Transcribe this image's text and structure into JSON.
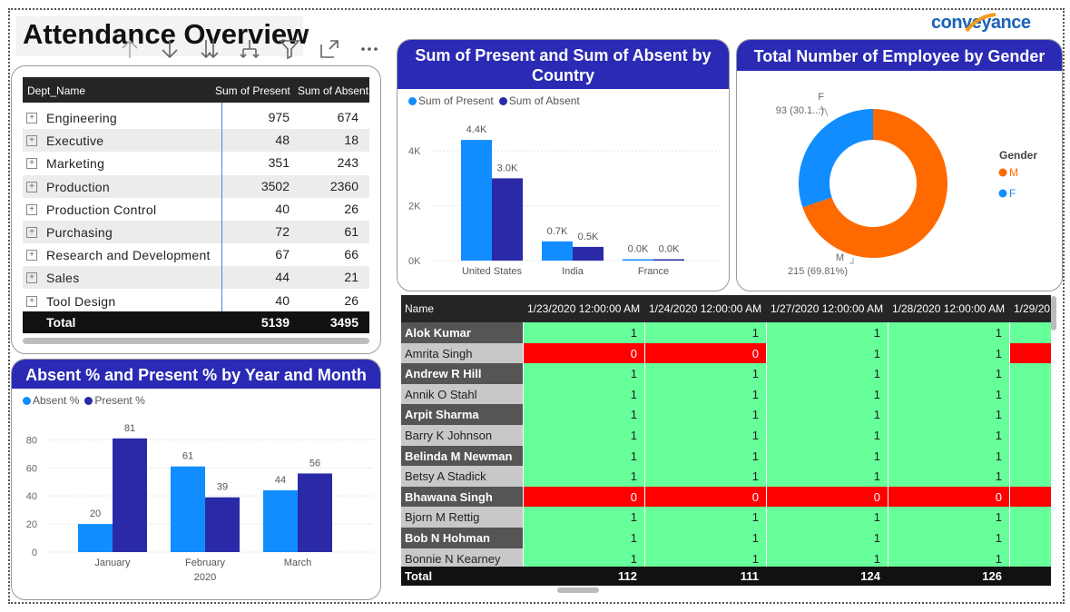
{
  "page": {
    "title": "Attendance Overview",
    "logo": "conveyance"
  },
  "toolbar": [
    {
      "icon": "drill-up-icon"
    },
    {
      "icon": "drill-down-icon"
    },
    {
      "icon": "expand-all-down-icon"
    },
    {
      "icon": "expand-hierarchy-icon"
    },
    {
      "icon": "filter-icon"
    },
    {
      "icon": "focus-mode-icon"
    },
    {
      "icon": "more-options-icon"
    }
  ],
  "dept_table": {
    "headers": {
      "name": "Dept_Name",
      "present": "Sum of Present",
      "absent": "Sum of Absent"
    },
    "rows": [
      {
        "name": "Engineering",
        "present": "975",
        "absent": "674"
      },
      {
        "name": "Executive",
        "present": "48",
        "absent": "18"
      },
      {
        "name": "Marketing",
        "present": "351",
        "absent": "243"
      },
      {
        "name": "Production",
        "present": "3502",
        "absent": "2360"
      },
      {
        "name": "Production Control",
        "present": "40",
        "absent": "26"
      },
      {
        "name": "Purchasing",
        "present": "72",
        "absent": "61"
      },
      {
        "name": "Research and Development",
        "present": "67",
        "absent": "66"
      },
      {
        "name": "Sales",
        "present": "44",
        "absent": "21"
      },
      {
        "name": "Tool Design",
        "present": "40",
        "absent": "26"
      }
    ],
    "total": {
      "label": "Total",
      "present": "5139",
      "absent": "3495"
    }
  },
  "country_chart": {
    "title": "Sum of Present and Sum of Absent by Country",
    "legend": [
      "Sum of Present",
      "Sum of Absent"
    ],
    "colors": [
      "#118dff",
      "#2a2aa8"
    ],
    "y_ticks": [
      "0K",
      "2K",
      "4K"
    ],
    "chart_data": {
      "type": "bar",
      "categories": [
        "United States",
        "India",
        "France"
      ],
      "series": [
        {
          "name": "Sum of Present",
          "values": [
            4400,
            700,
            0
          ],
          "labels": [
            "4.4K",
            "0.7K",
            "0.0K"
          ]
        },
        {
          "name": "Sum of Absent",
          "values": [
            3000,
            500,
            0
          ],
          "labels": [
            "3.0K",
            "0.5K",
            "0.0K"
          ]
        }
      ],
      "ylim": [
        0,
        4800
      ]
    }
  },
  "gender_chart": {
    "title": "Total Number of Employee by Gender",
    "legend_title": "Gender",
    "colors": [
      "#ff6a00",
      "#118dff"
    ],
    "chart_data": {
      "type": "pie",
      "categories": [
        "M",
        "F"
      ],
      "values": [
        215,
        93
      ],
      "labels": [
        "215 (69.81%)",
        "93 (30.1...)"
      ]
    }
  },
  "month_chart": {
    "title": "Absent % and Present % by Year and Month",
    "legend": [
      "Absent %",
      "Present %"
    ],
    "colors": [
      "#118dff",
      "#2a2aa8"
    ],
    "y_ticks": [
      "0",
      "20",
      "40",
      "60",
      "80"
    ],
    "year_label": "2020",
    "chart_data": {
      "type": "bar",
      "categories": [
        "January",
        "February",
        "March"
      ],
      "series": [
        {
          "name": "Absent %",
          "values": [
            20,
            61,
            44
          ]
        },
        {
          "name": "Present %",
          "values": [
            81,
            39,
            56
          ]
        }
      ],
      "ylim": [
        0,
        88
      ]
    }
  },
  "matrix": {
    "headers": [
      "Name",
      "1/23/2020 12:00:00 AM",
      "1/24/2020 12:00:00 AM",
      "1/27/2020 12:00:00 AM",
      "1/28/2020 12:00:00 AM",
      "1/29/20"
    ],
    "colors": {
      "present": "#66ff99",
      "absent": "#ff0000"
    },
    "rows": [
      {
        "name": "Alok Kumar",
        "values": [
          "1",
          "1",
          "1",
          "1"
        ],
        "last": "present"
      },
      {
        "name": "Amrita Singh",
        "values": [
          "0",
          "0",
          "1",
          "1"
        ],
        "last": "absent"
      },
      {
        "name": "Andrew R Hill",
        "values": [
          "1",
          "1",
          "1",
          "1"
        ],
        "last": "present"
      },
      {
        "name": "Annik O Stahl",
        "values": [
          "1",
          "1",
          "1",
          "1"
        ],
        "last": "present"
      },
      {
        "name": "Arpit Sharma",
        "values": [
          "1",
          "1",
          "1",
          "1"
        ],
        "last": "present"
      },
      {
        "name": "Barry K Johnson",
        "values": [
          "1",
          "1",
          "1",
          "1"
        ],
        "last": "present"
      },
      {
        "name": "Belinda M Newman",
        "values": [
          "1",
          "1",
          "1",
          "1"
        ],
        "last": "present"
      },
      {
        "name": "Betsy A Stadick",
        "values": [
          "1",
          "1",
          "1",
          "1"
        ],
        "last": "present"
      },
      {
        "name": "Bhawana Singh",
        "values": [
          "0",
          "0",
          "0",
          "0"
        ],
        "last": "absent"
      },
      {
        "name": "Bjorn M Rettig",
        "values": [
          "1",
          "1",
          "1",
          "1"
        ],
        "last": "present"
      },
      {
        "name": "Bob N Hohman",
        "values": [
          "1",
          "1",
          "1",
          "1"
        ],
        "last": "present"
      },
      {
        "name": "Bonnie N Kearney",
        "values": [
          "1",
          "1",
          "1",
          "1"
        ],
        "last": "present"
      }
    ],
    "total": {
      "label": "Total",
      "values": [
        "112",
        "111",
        "124",
        "126"
      ]
    }
  }
}
